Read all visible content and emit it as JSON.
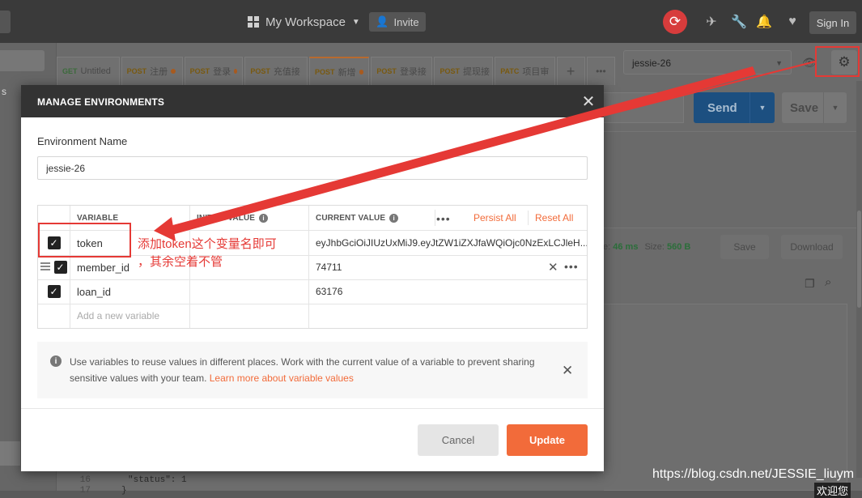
{
  "header": {
    "workspace": "My Workspace",
    "invite": "Invite",
    "sign_in": "Sign In"
  },
  "sidebar": {
    "tab_letter": "s"
  },
  "tabs": [
    {
      "method": "GET",
      "label": "Untitled",
      "dot": false
    },
    {
      "method": "POST",
      "label": "注册",
      "dot": true
    },
    {
      "method": "POST",
      "label": "登录",
      "dot": true
    },
    {
      "method": "POST",
      "label": "充值接",
      "dot": false
    },
    {
      "method": "POST",
      "label": "新增",
      "dot": true,
      "active": true
    },
    {
      "method": "POST",
      "label": "登录接",
      "dot": false
    },
    {
      "method": "POST",
      "label": "提现接",
      "dot": false
    },
    {
      "method": "PATC",
      "label": "项目审",
      "dot": false
    }
  ],
  "environment": {
    "selected": "jessie-26"
  },
  "request": {
    "send": "Send",
    "save": "Save"
  },
  "response": {
    "time_label": "e:",
    "time_value": "46 ms",
    "size_label": "Size:",
    "size_value": "560 B",
    "save_response": "Save",
    "download": "Download"
  },
  "code": [
    {
      "line": "16",
      "text": "\"status\": 1"
    },
    {
      "line": "17",
      "text": "}"
    }
  ],
  "modal": {
    "title": "MANAGE ENVIRONMENTS",
    "env_name_label": "Environment Name",
    "env_name_value": "jessie-26",
    "columns": {
      "variable": "VARIABLE",
      "initial": "INITIAL VALUE",
      "current": "CURRENT VALUE",
      "persist_all": "Persist All",
      "reset_all": "Reset All"
    },
    "rows": [
      {
        "checked": true,
        "name": "token",
        "initial": "",
        "current": "eyJhbGciOiJIUzUxMiJ9.eyJtZW1iZXJfaWQiOjc0NzExLCJleH..."
      },
      {
        "checked": true,
        "name": "member_id",
        "initial": "",
        "current": "74711"
      },
      {
        "checked": true,
        "name": "loan_id",
        "initial": "",
        "current": "63176"
      }
    ],
    "new_variable_placeholder": "Add a new variable",
    "info_text": "Use variables to reuse values in different places. Work with the current value of a variable to prevent sharing sensitive values with your team.",
    "info_link": "Learn more about variable values",
    "cancel": "Cancel",
    "update": "Update"
  },
  "annotation": {
    "line1": "添加token这个变量名即可",
    "line2": "，其余空着不管",
    "color": "#e53935"
  },
  "watermark": "https://blog.csdn.net/JESSIE_liuym",
  "watermark2": "欢迎您",
  "icons": {
    "sync": "sync-icon",
    "satellite": "satellite-icon",
    "wrench": "wrench-icon",
    "bell": "bell-icon",
    "heart": "heart-icon",
    "eye": "eye-icon",
    "gear": "gear-icon"
  }
}
